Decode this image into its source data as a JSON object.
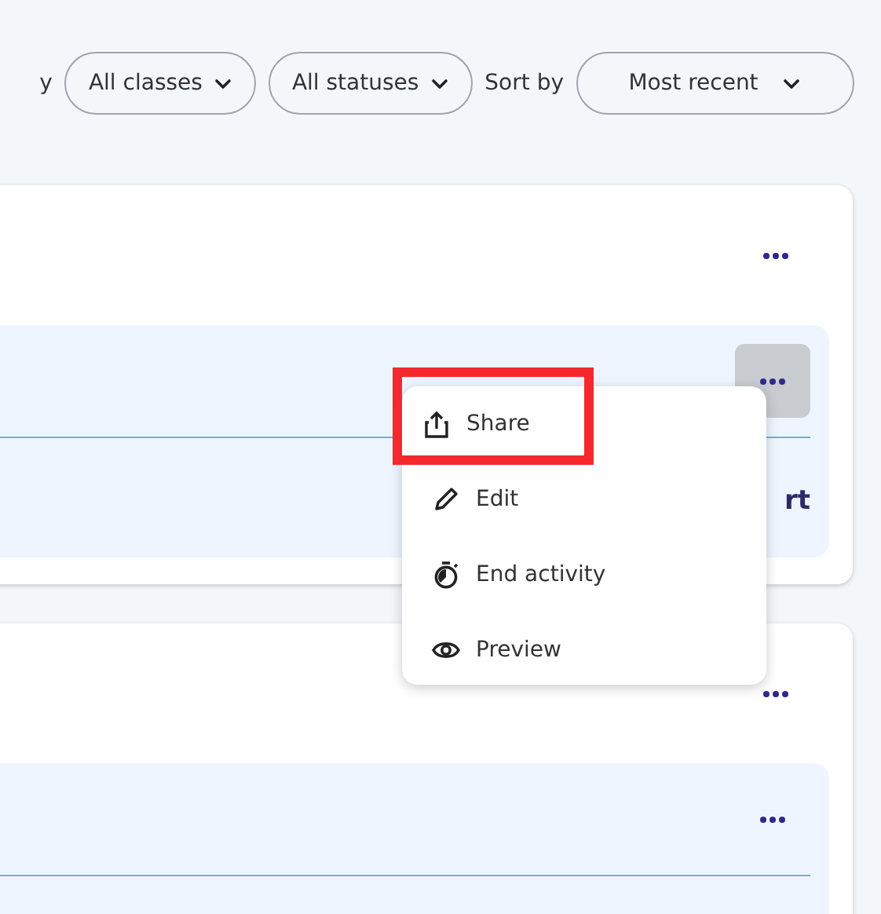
{
  "filters": {
    "leading_label": "y",
    "dropdowns": [
      {
        "label": "All classes"
      },
      {
        "label": "All statuses"
      }
    ],
    "sort_label": "Sort by",
    "sort": {
      "label": "Most recent"
    }
  },
  "cards": [
    {
      "panel": {
        "menu_open": true,
        "footer_text": "rt"
      }
    },
    {
      "panel": {
        "menu_open": false
      }
    }
  ],
  "menu": {
    "items": [
      {
        "kind": "share",
        "label": "Share",
        "highlighted": true
      },
      {
        "kind": "edit",
        "label": "Edit",
        "highlighted": false
      },
      {
        "kind": "end",
        "label": "End activity",
        "highlighted": false
      },
      {
        "kind": "preview",
        "label": "Preview",
        "highlighted": false
      }
    ]
  }
}
